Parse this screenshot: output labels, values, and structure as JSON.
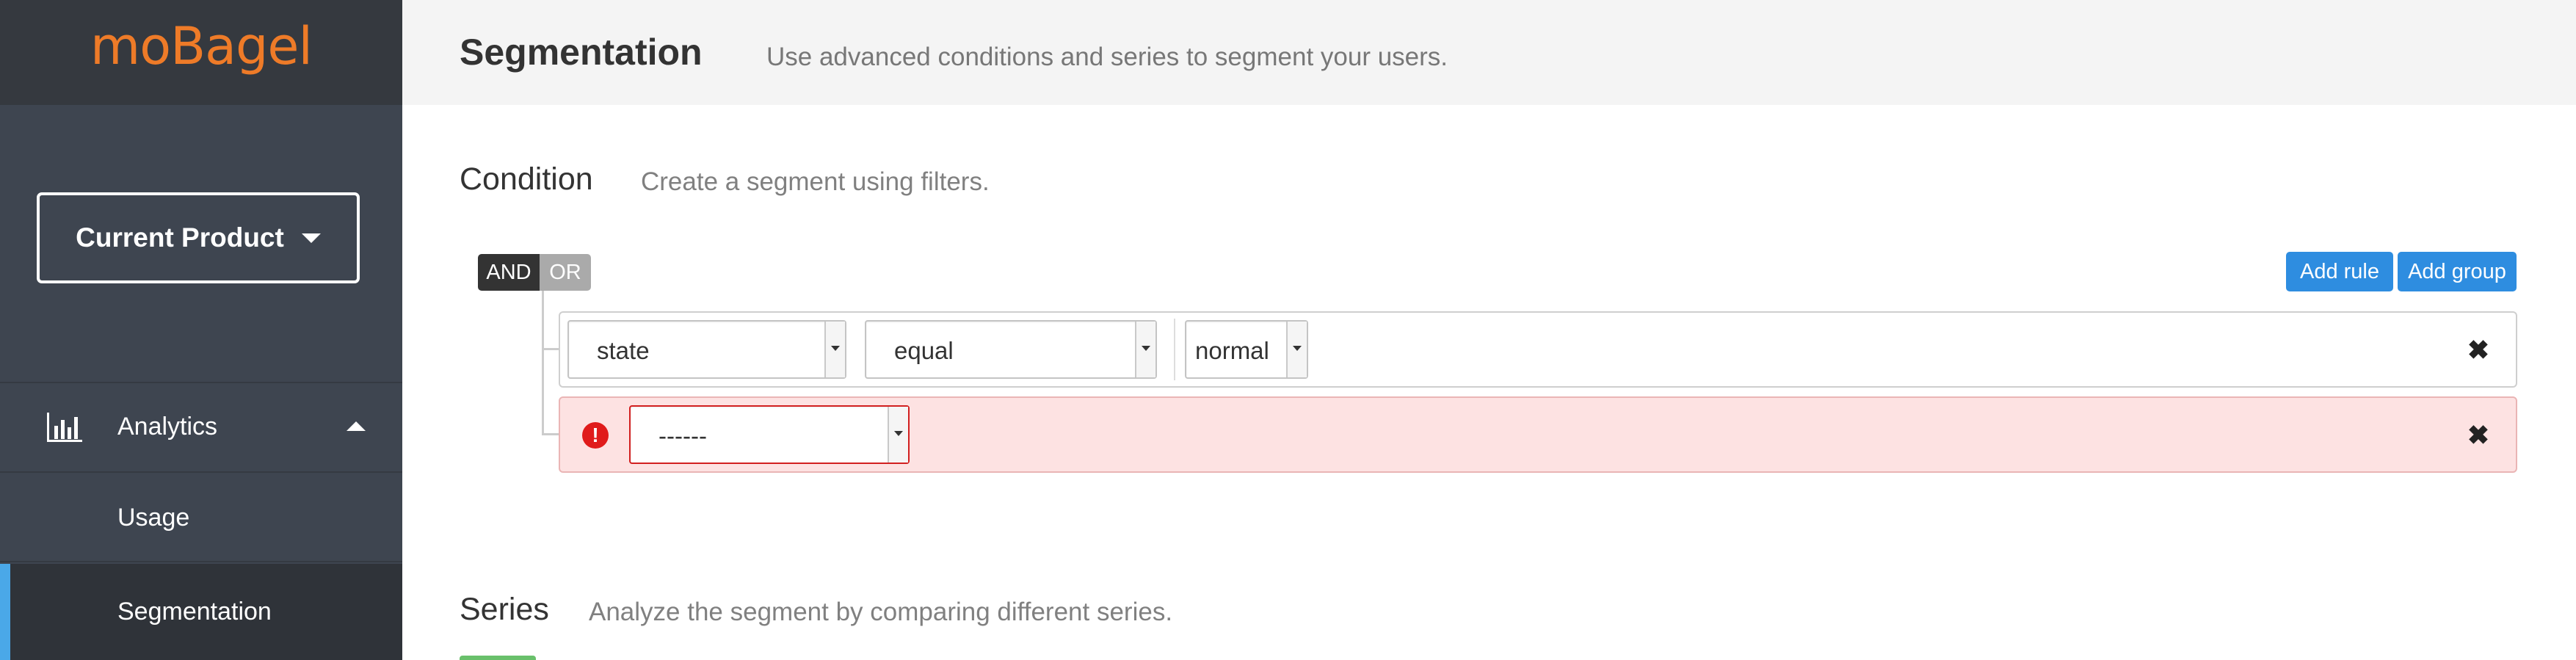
{
  "brand": {
    "logo_text": "moBagel",
    "color": "#ee7b28"
  },
  "sidebar": {
    "product_button": "Current Product",
    "analytics_label": "Analytics",
    "items": [
      {
        "label": "Usage"
      },
      {
        "label": "Segmentation",
        "active": true
      }
    ]
  },
  "header": {
    "title": "Segmentation",
    "subtitle": "Use advanced conditions and series to segment your users."
  },
  "condition": {
    "title": "Condition",
    "subtitle": "Create a segment using filters.",
    "and_label": "AND",
    "or_label": "OR",
    "add_rule": "Add rule",
    "add_group": "Add group",
    "rules": [
      {
        "field": "state",
        "operator": "equal",
        "value": "normal"
      },
      {
        "field": "------",
        "error": true
      }
    ]
  },
  "series": {
    "title": "Series",
    "subtitle": "Analyze the segment by comparing different series."
  },
  "colors": {
    "sidebar": "#3e4550",
    "accent": "#4aa8e8",
    "primary": "#2e8de0",
    "error": "#e01b1b"
  }
}
